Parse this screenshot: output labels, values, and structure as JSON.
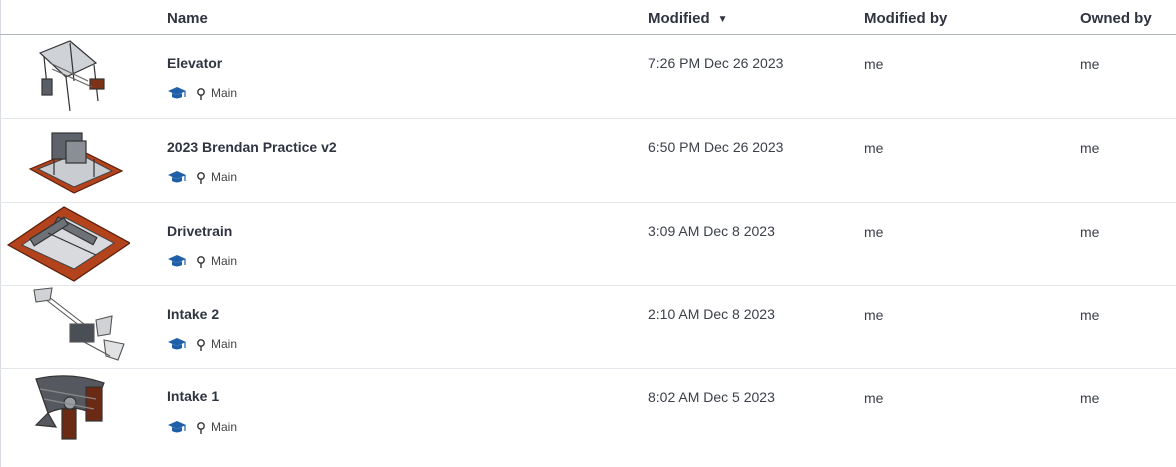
{
  "columns": {
    "name": "Name",
    "modified": "Modified",
    "modified_sort_indicator": "▼",
    "modified_by": "Modified by",
    "owned_by": "Owned by"
  },
  "rows": [
    {
      "name": "Elevator",
      "branch": "Main",
      "modified": "7:26 PM Dec 26 2023",
      "modified_by": "me",
      "owned_by": "me",
      "thumbnail_icon": "cad-model-thumbnail"
    },
    {
      "name": "2023 Brendan Practice v2",
      "branch": "Main",
      "modified": "6:50 PM Dec 26 2023",
      "modified_by": "me",
      "owned_by": "me",
      "thumbnail_icon": "cad-model-thumbnail"
    },
    {
      "name": "Drivetrain",
      "branch": "Main",
      "modified": "3:09 AM Dec 8 2023",
      "modified_by": "me",
      "owned_by": "me",
      "thumbnail_icon": "cad-model-thumbnail"
    },
    {
      "name": "Intake 2",
      "branch": "Main",
      "modified": "2:10 AM Dec 8 2023",
      "modified_by": "me",
      "owned_by": "me",
      "thumbnail_icon": "cad-model-thumbnail"
    },
    {
      "name": "Intake 1",
      "branch": "Main",
      "modified": "8:02 AM Dec 5 2023",
      "modified_by": "me",
      "owned_by": "me",
      "thumbnail_icon": "cad-model-thumbnail"
    }
  ],
  "colors": {
    "education_icon": "#1f5fa8",
    "frame_orange": "#b2431c",
    "metal_gray": "#6d7178"
  }
}
